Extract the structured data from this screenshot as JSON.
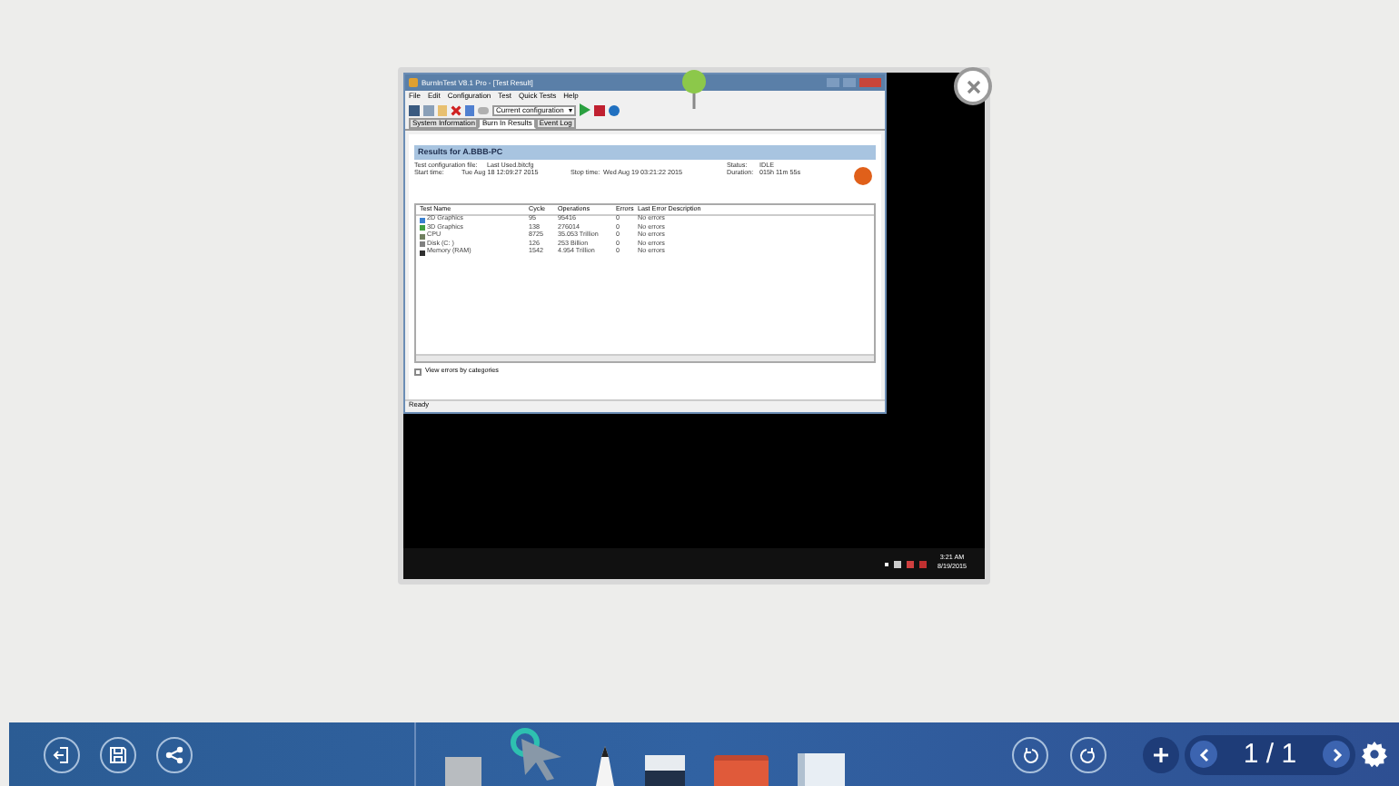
{
  "window": {
    "title": "BurnInTest V8.1 Pro - [Test Result]"
  },
  "menu": [
    "File",
    "Edit",
    "Configuration",
    "Test",
    "Quick Tests",
    "Help"
  ],
  "toolbar": {
    "configuration": "Current configuration"
  },
  "tabs": [
    {
      "label": "System Information",
      "selected": false
    },
    {
      "label": "Burn In Results",
      "selected": true
    },
    {
      "label": "Event Log",
      "selected": false
    }
  ],
  "results": {
    "heading": "Results for A.BBB-PC",
    "config_label": "Test configuration file:",
    "config_value": "Last Used.bitcfg",
    "status_label": "Status:",
    "status_value": "IDLE",
    "start_label": "Start time:",
    "start_value": "Tue Aug 18 12:09:27 2015",
    "stop_label": "Stop time:",
    "stop_value": "Wed Aug 19 03:21:22 2015",
    "duration_label": "Duration:",
    "duration_value": "015h 11m 55s"
  },
  "table": {
    "columns": [
      "Test Name",
      "Cycle",
      "Operations",
      "Errors",
      "Last Error Description"
    ],
    "rows": [
      {
        "kind": "display",
        "cells": [
          "2D Graphics",
          "95",
          "95416",
          "0",
          "No errors"
        ]
      },
      {
        "kind": "graphics3d",
        "cells": [
          "3D Graphics",
          "138",
          "276014",
          "0",
          "No errors"
        ]
      },
      {
        "kind": "cpu",
        "cells": [
          "CPU",
          "8725",
          "35.053 Trillion",
          "0",
          "No errors"
        ]
      },
      {
        "kind": "disk",
        "cells": [
          "Disk (C: )",
          "126",
          "253 Billion",
          "0",
          "No errors"
        ]
      },
      {
        "kind": "memory",
        "cells": [
          "Memory (RAM)",
          "1542",
          "4.954 Trillion",
          "0",
          "No errors"
        ]
      }
    ]
  },
  "view_by_category": {
    "label": "View errors by categories",
    "checked": false
  },
  "status_bar": "Ready",
  "tray": {
    "time": "3:21 AM",
    "date": "8/19/2015"
  },
  "tools": [
    {
      "kind": "background",
      "selected": false
    },
    {
      "kind": "pointer",
      "selected": true
    },
    {
      "kind": "pen",
      "selected": false
    },
    {
      "kind": "eraser",
      "selected": false
    },
    {
      "kind": "toolbox",
      "selected": false
    },
    {
      "kind": "document",
      "selected": false
    }
  ],
  "page_indicator": "1 / 1"
}
